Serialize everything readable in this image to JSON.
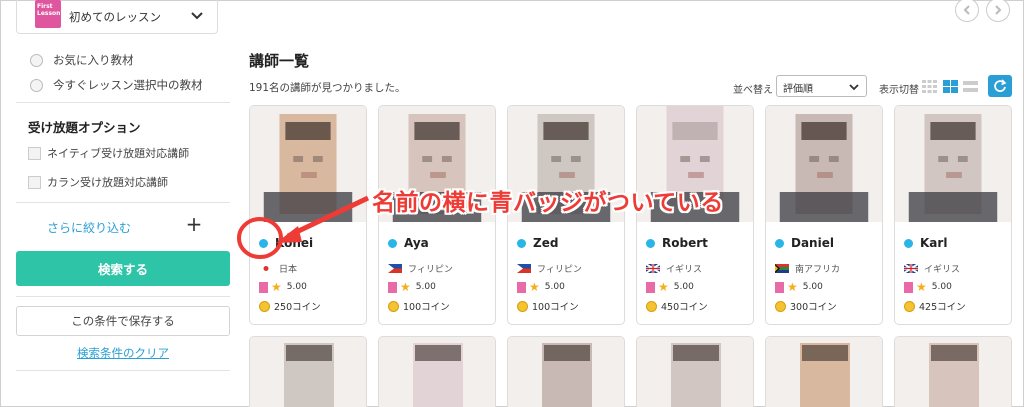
{
  "sidebar": {
    "course": {
      "thumb_text": "First Lesson",
      "label": "初めてのレッスン"
    },
    "radios": [
      {
        "label": "お気に入り教材"
      },
      {
        "label": "今すぐレッスン選択中の教材"
      }
    ],
    "unlimited": {
      "title": "受け放題オプション",
      "options": [
        {
          "label": "ネイティブ受け放題対応講師"
        },
        {
          "label": "カラン受け放題対応講師"
        }
      ]
    },
    "narrow_link": "さらに絞り込む",
    "plus_label": "+",
    "search_button": "検索する",
    "save_button": "この条件で保存する",
    "clear_link": "検索条件のクリア"
  },
  "main": {
    "title": "講師一覧",
    "result_count": "191名の講師が見つかりました。",
    "sort_label": "並べ替え",
    "sort_value": "評価順",
    "view_label": "表示切替"
  },
  "teachers": [
    {
      "name": "Kohei",
      "country": "日本",
      "flag": "jp",
      "rating": "5.00",
      "coins": "250コイン"
    },
    {
      "name": "Aya",
      "country": "フィリピン",
      "flag": "ph",
      "rating": "5.00",
      "coins": "100コイン"
    },
    {
      "name": "Zed",
      "country": "フィリピン",
      "flag": "ph",
      "rating": "5.00",
      "coins": "100コイン"
    },
    {
      "name": "Robert",
      "country": "イギリス",
      "flag": "uk",
      "rating": "5.00",
      "coins": "450コイン"
    },
    {
      "name": "Daniel",
      "country": "南アフリカ",
      "flag": "za",
      "rating": "5.00",
      "coins": "300コイン"
    },
    {
      "name": "Karl",
      "country": "イギリス",
      "flag": "uk",
      "rating": "5.00",
      "coins": "425コイン"
    }
  ],
  "annotation": "名前の横に青バッジがついている",
  "colors": {
    "accent_green": "#2ec4a7",
    "accent_blue": "#2a9fd6",
    "badge_blue": "#2ab5e8",
    "annotation_red": "#ef3b35"
  }
}
